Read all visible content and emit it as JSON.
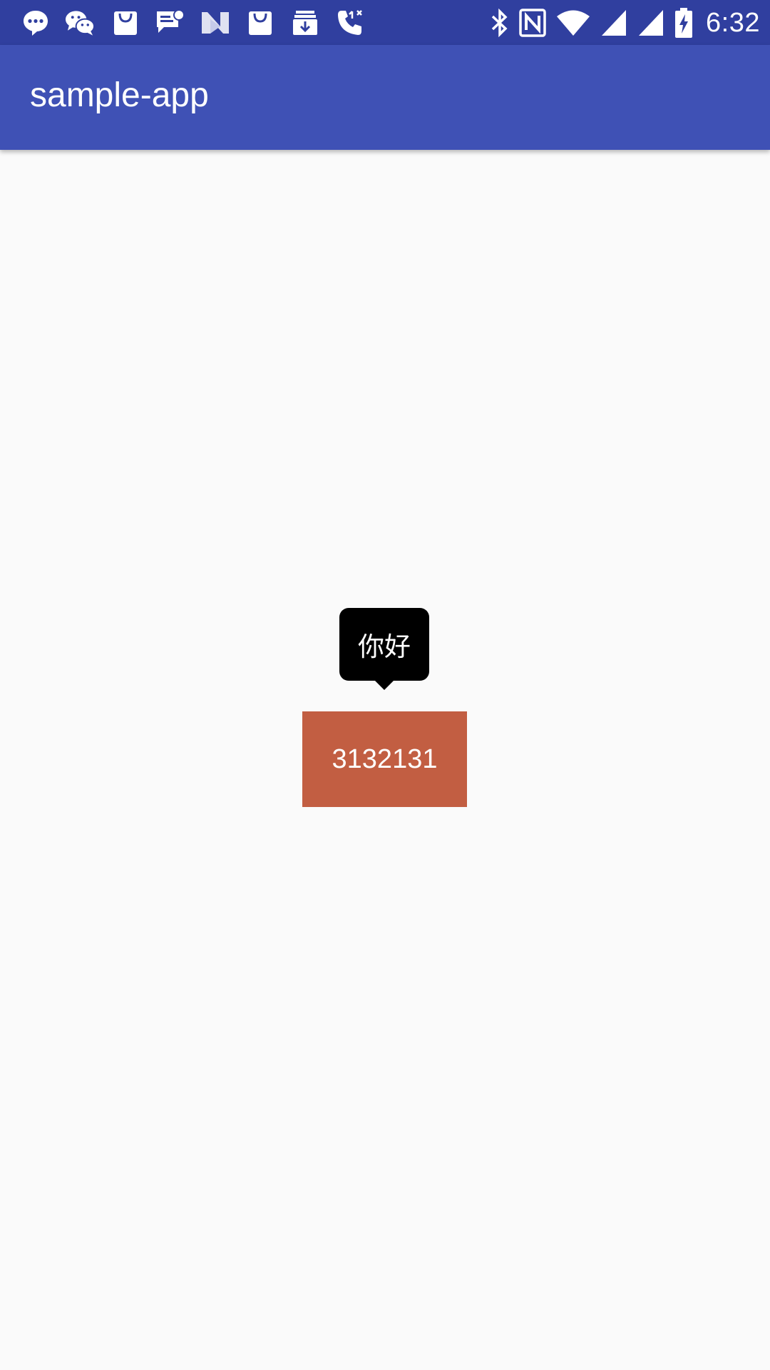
{
  "status_bar": {
    "time": "6:32",
    "left_icons": [
      "messaging-icon",
      "wechat-icon",
      "shopping-bag-icon",
      "sms-notification-icon",
      "n-app-icon",
      "shopping-bag-icon",
      "download-tray-icon",
      "missed-call-icon"
    ],
    "right_icons": [
      "bluetooth-icon",
      "nfc-icon",
      "wifi-icon",
      "cell-signal-icon",
      "cell-signal-icon",
      "battery-charging-icon"
    ],
    "background_color": "#303f9f"
  },
  "app_bar": {
    "title": "sample-app",
    "background_color": "#3f51b5"
  },
  "tooltip": {
    "text": "你好",
    "background_color": "#000000"
  },
  "main_button": {
    "label": "3132131",
    "background_color": "#c25e42"
  }
}
